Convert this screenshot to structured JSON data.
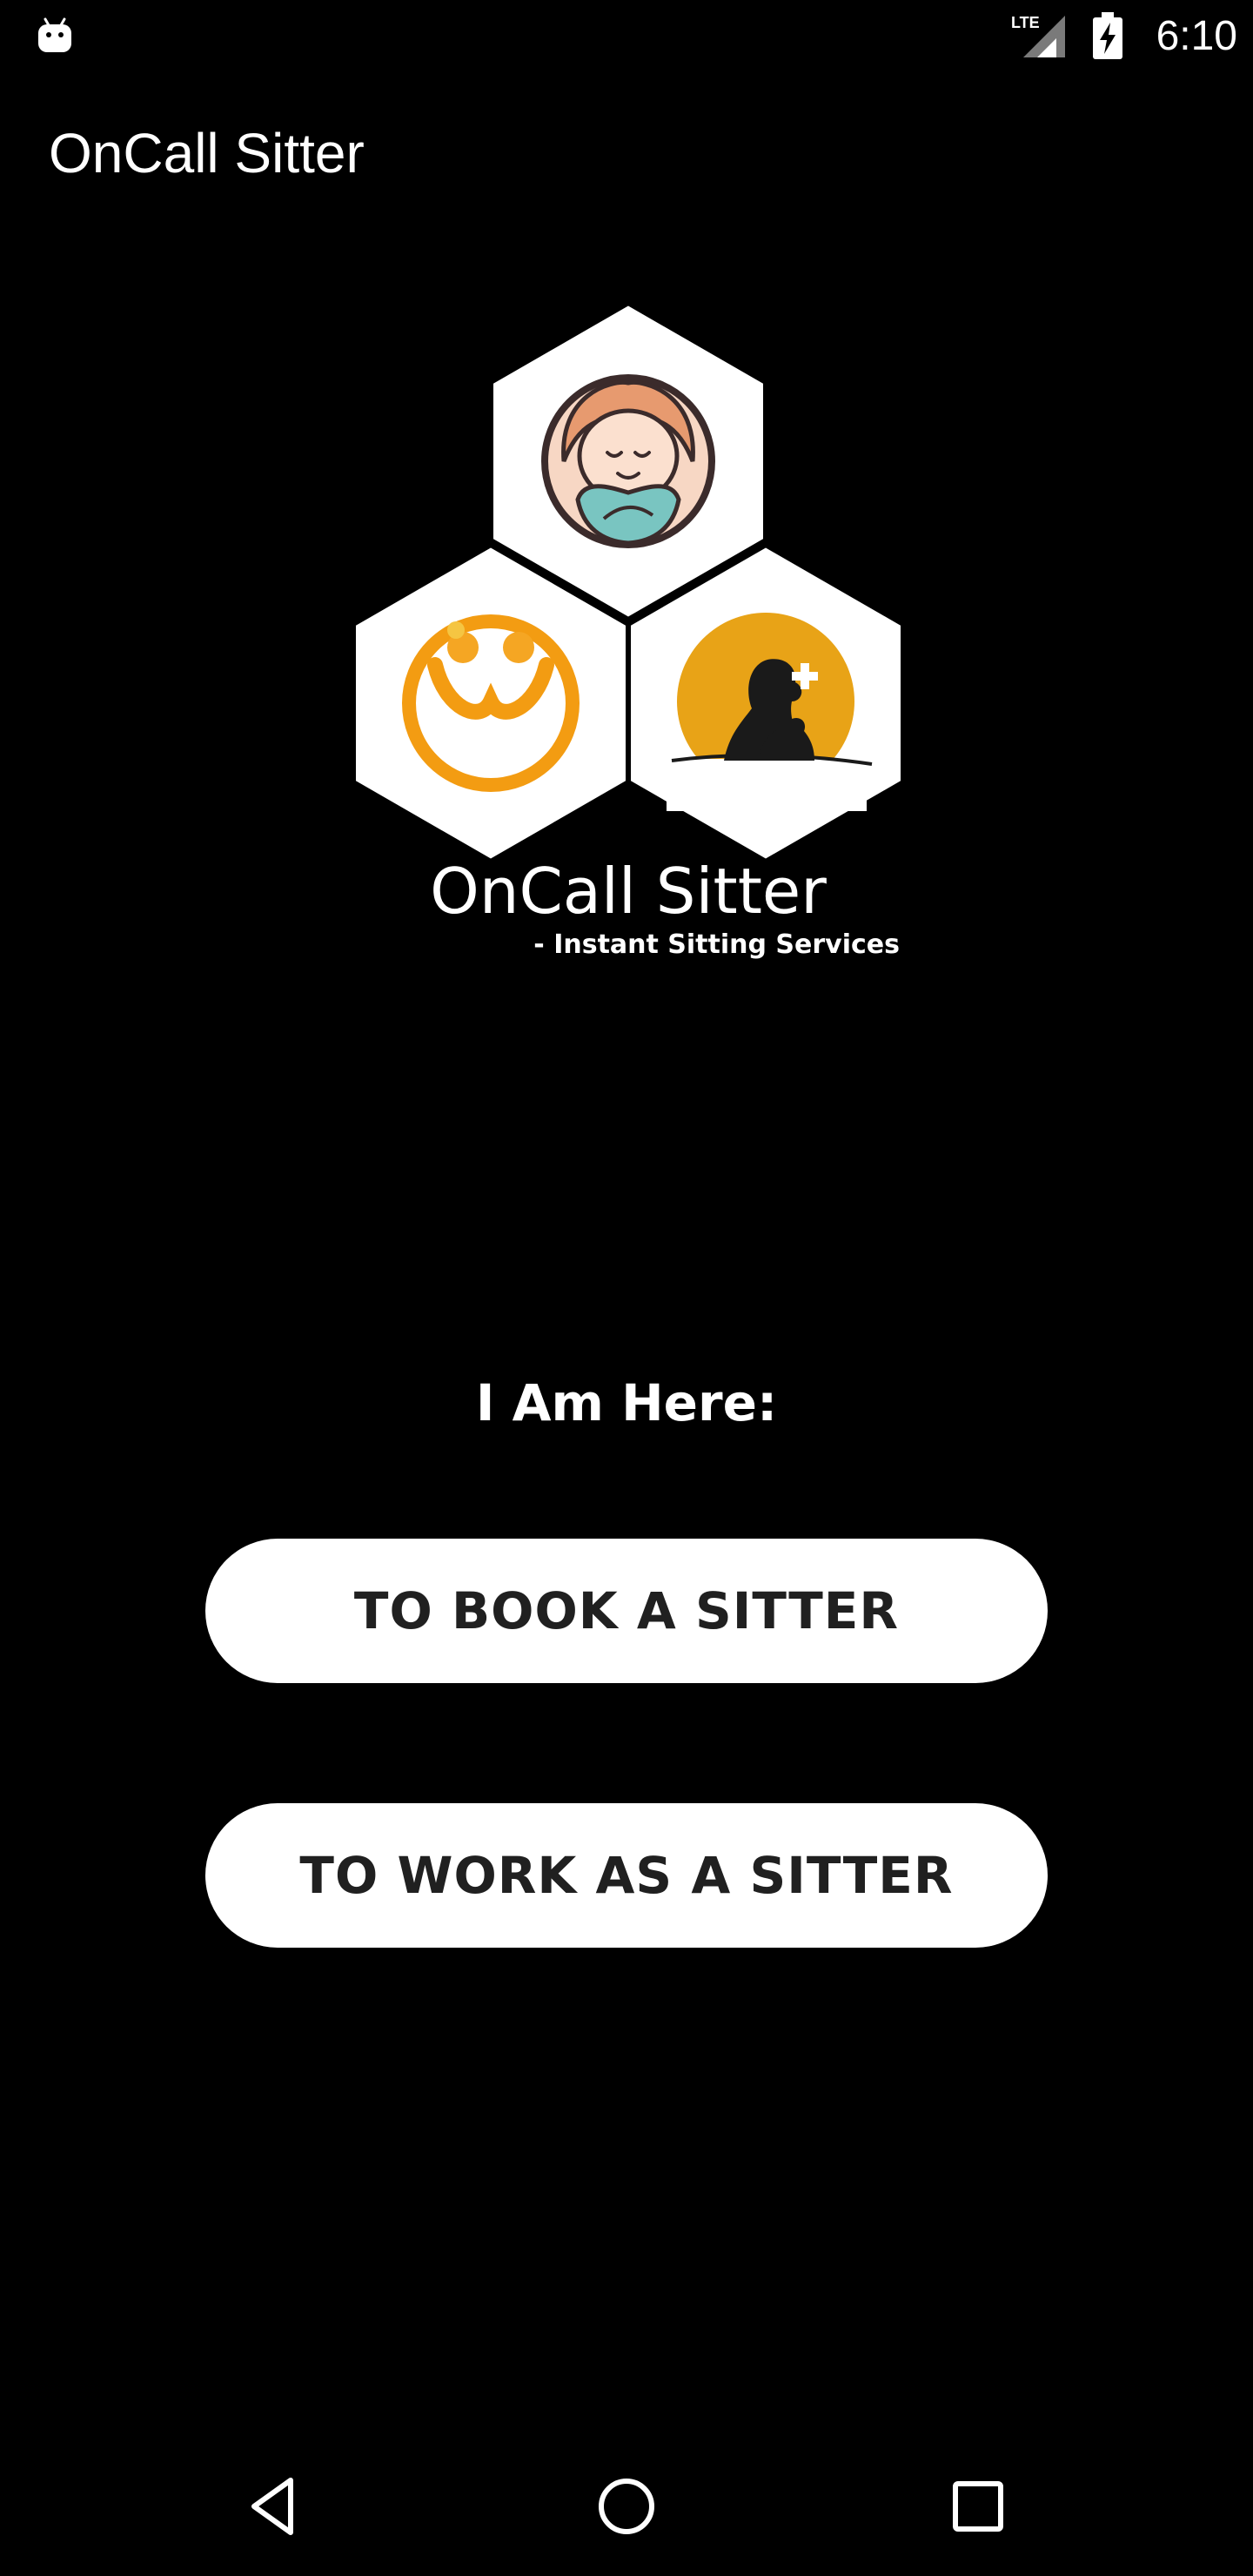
{
  "status_bar": {
    "time": "6:10",
    "network_label": "LTE",
    "icons": [
      "android-icon",
      "lte-signal-icon",
      "battery-charging-icon"
    ]
  },
  "app_bar": {
    "title": "OnCall Sitter"
  },
  "logo": {
    "name": "OnCall Sitter",
    "tagline": "- Instant Sitting Services",
    "icons": [
      "baby-icon",
      "elder-care-icon",
      "pet-care-icon"
    ]
  },
  "main": {
    "prompt": "I Am Here:",
    "book_button_label": "TO BOOK A SITTER",
    "work_button_label": "TO WORK AS A SITTER"
  },
  "nav_bar": {
    "icons": [
      "back-icon",
      "home-icon",
      "recents-icon"
    ]
  },
  "colors": {
    "background": "#000000",
    "button_bg": "#ffffff",
    "button_text": "#202020",
    "accent_orange": "#f39c12",
    "accent_gold": "#e8a317"
  }
}
